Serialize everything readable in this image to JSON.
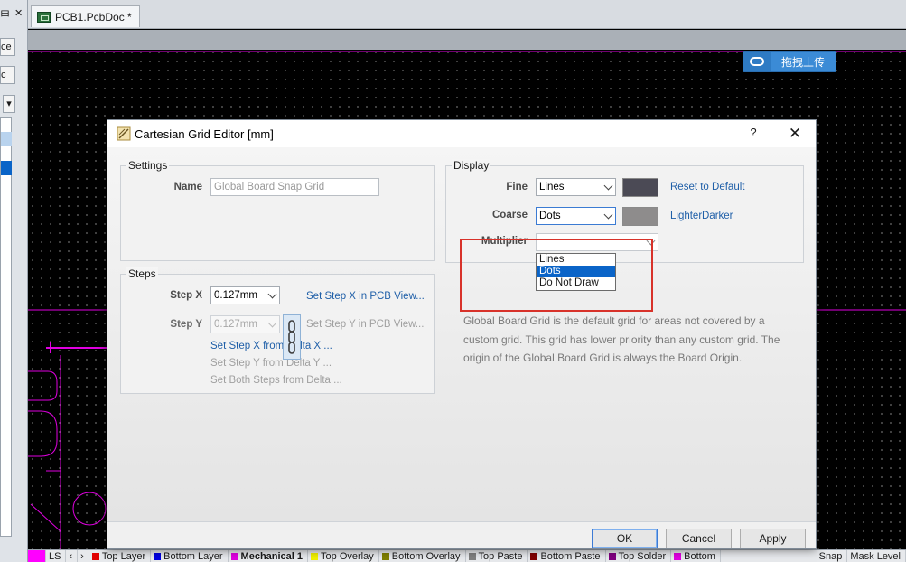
{
  "left_panel": {
    "title_glyph": "甲",
    "pin_glyph": "▾",
    "close_glyph": "✕",
    "button1_label": "ce",
    "button2_label": "c",
    "dropdown_glyph": "▾"
  },
  "doc_tab": {
    "label": "PCB1.PcbDoc *"
  },
  "upload_button": {
    "label": "拖拽上传"
  },
  "dialog": {
    "title": "Cartesian Grid Editor [mm]",
    "help": "?",
    "close": "✕",
    "settings": {
      "title": "Settings",
      "name_label": "Name",
      "name_value": "Global Board Snap Grid"
    },
    "steps": {
      "title": "Steps",
      "step_x_label": "Step X",
      "step_x_value": "0.127mm",
      "step_y_label": "Step Y",
      "step_y_value": "0.127mm",
      "set_step_x_pcb": "Set Step X in PCB View...",
      "set_step_y_pcb": "Set Step Y in PCB View...",
      "set_step_x_delta": "Set Step X from Delta X ...",
      "set_step_y_delta": "Set Step Y from Delta Y ...",
      "set_both_delta": "Set Both Steps from Delta ..."
    },
    "display": {
      "title": "Display",
      "fine_label": "Fine",
      "fine_value": "Lines",
      "coarse_label": "Coarse",
      "coarse_value": "Dots",
      "multiplier_label": "Multiplier",
      "reset_link": "Reset to Default",
      "lighter_link": "Lighter",
      "darker_link": "Darker",
      "fine_color": "#4b4a55",
      "coarse_color": "#8e8c8c",
      "dropdown_options": [
        "Lines",
        "Dots",
        "Do Not Draw"
      ]
    },
    "description": "Global Board Grid is the default grid for areas not covered by a custom grid. This grid has lower priority than any custom grid. The origin of the Global Board Grid is always the Board Origin.",
    "buttons": {
      "ok": "OK",
      "cancel": "Cancel",
      "apply": "Apply"
    }
  },
  "layer_tabs": {
    "ls_label": "LS",
    "nav_left": "‹",
    "nav_right": "›",
    "layers": [
      {
        "name": "Top Layer",
        "color": "#e00000"
      },
      {
        "name": "Bottom Layer",
        "color": "#0000e0"
      },
      {
        "name": "Mechanical 1",
        "color": "#e000e0"
      },
      {
        "name": "Top Overlay",
        "color": "#f0f000"
      },
      {
        "name": "Bottom Overlay",
        "color": "#808000"
      },
      {
        "name": "Top Paste",
        "color": "#808080"
      },
      {
        "name": "Bottom Paste",
        "color": "#800000"
      },
      {
        "name": "Top Solder",
        "color": "#800080"
      },
      {
        "name": "Bottom",
        "color": "#e000e0"
      }
    ],
    "snap": "Snap",
    "mask_level": "Mask Level"
  },
  "colors": {
    "pcb_outline": "#e000e0",
    "callout": "#d8322a",
    "accent_blue": "#1f5fa8",
    "upload_blue": "#3b8bd6"
  }
}
